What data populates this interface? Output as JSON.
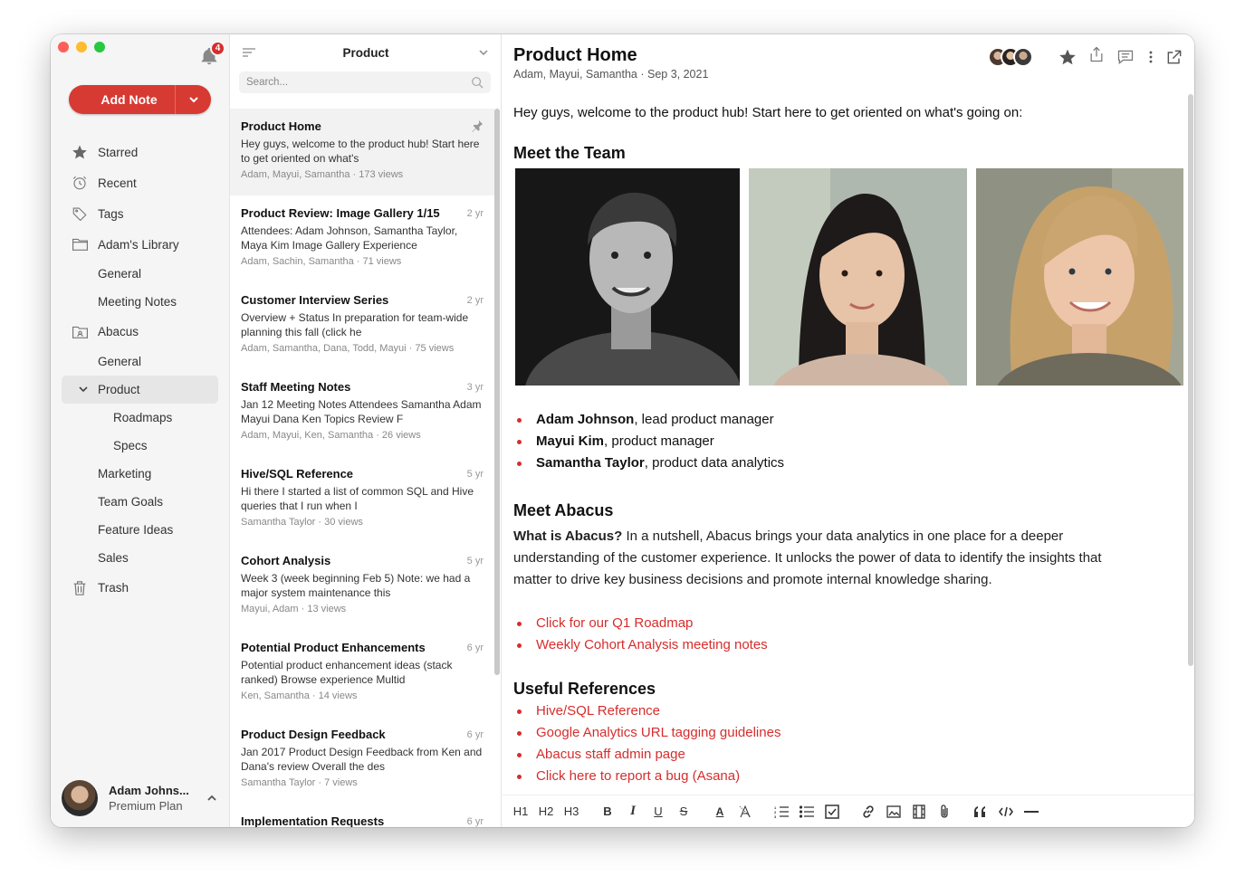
{
  "notifications": {
    "count": "4"
  },
  "sidebar": {
    "add_note_label": "Add Note",
    "items": [
      {
        "label": "Starred"
      },
      {
        "label": "Recent"
      },
      {
        "label": "Tags"
      },
      {
        "label": "Adam's Library"
      },
      {
        "label": "General"
      },
      {
        "label": "Meeting Notes"
      },
      {
        "label": "Abacus"
      },
      {
        "label": "General"
      },
      {
        "label": "Product"
      },
      {
        "label": "Roadmaps"
      },
      {
        "label": "Specs"
      },
      {
        "label": "Marketing"
      },
      {
        "label": "Team Goals"
      },
      {
        "label": "Feature Ideas"
      },
      {
        "label": "Sales"
      },
      {
        "label": "Trash"
      }
    ],
    "user": {
      "name": "Adam Johns...",
      "plan": "Premium Plan"
    }
  },
  "list": {
    "title": "Product",
    "search_placeholder": "Search...",
    "notes": [
      {
        "title": "Product Home",
        "age": "",
        "excerpt": "Hey guys, welcome to the product hub! Start here to get oriented on what's",
        "meta": "Adam, Mayui, Samantha · 173 views"
      },
      {
        "title": "Product Review: Image Gallery 1/15",
        "age": "2 yr",
        "excerpt": "Attendees: Adam Johnson, Samantha Taylor, Maya Kim Image Gallery Experience",
        "meta": "Adam, Sachin, Samantha · 71 views"
      },
      {
        "title": "Customer Interview Series",
        "age": "2 yr",
        "excerpt": "Overview + Status In preparation for team-wide planning this fall (click he",
        "meta": "Adam, Samantha, Dana, Todd, Mayui · 75 views"
      },
      {
        "title": "Staff Meeting Notes",
        "age": "3 yr",
        "excerpt": "Jan 12 Meeting Notes Attendees Samantha Adam Mayui Dana Ken Topics Review F",
        "meta": "Adam, Mayui, Ken, Samantha · 26 views"
      },
      {
        "title": "Hive/SQL Reference",
        "age": "5 yr",
        "excerpt": "Hi there I started a list of common SQL and Hive queries that I run when I",
        "meta": "Samantha Taylor · 30 views"
      },
      {
        "title": "Cohort Analysis",
        "age": "5 yr",
        "excerpt": "Week 3 (week beginning Feb 5) Note: we had a major system maintenance this",
        "meta": "Mayui, Adam · 13 views"
      },
      {
        "title": "Potential Product Enhancements",
        "age": "6 yr",
        "excerpt": "Potential product enhancement ideas (stack ranked) Browse experience Multid",
        "meta": "Ken, Samantha · 14 views"
      },
      {
        "title": "Product Design Feedback",
        "age": "6 yr",
        "excerpt": "Jan 2017 Product Design Feedback from Ken and Dana's review Overall the des",
        "meta": "Samantha Taylor · 7 views"
      },
      {
        "title": "Implementation Requests",
        "age": "6 yr",
        "excerpt": "",
        "meta": ""
      }
    ]
  },
  "doc": {
    "title": "Product Home",
    "subtitle": "Adam, Mayui, Samantha · Sep 3, 2021",
    "intro": "Hey guys, welcome to the product hub! Start here to get oriented on what's going on:",
    "team_heading": "Meet the Team",
    "team": [
      {
        "name": "Adam Johnson",
        "role": ", lead product manager"
      },
      {
        "name": "Mayui Kim",
        "role": ", product manager"
      },
      {
        "name": "Samantha Taylor",
        "role": ", product data analytics"
      }
    ],
    "abacus_heading": "Meet Abacus",
    "abacus_lead": "What is Abacus?",
    "abacus_text": " In a nutshell, Abacus brings your data analytics in one place for a deeper understanding of the customer experience. It unlocks the power of data to identify the insights that matter to drive key business decisions and promote internal knowledge sharing.",
    "abacus_links": [
      "Click for our Q1 Roadmap",
      "Weekly Cohort Analysis meeting notes"
    ],
    "refs_heading": "Useful References",
    "refs": [
      "Hive/SQL Reference",
      "Google Analytics URL tagging guidelines",
      "Abacus staff admin page",
      "Click here to report a bug (Asana)"
    ]
  },
  "format_bar": {
    "h1": "H1",
    "h2": "H2",
    "h3": "H3",
    "bold": "B",
    "italic": "I",
    "underline": "U",
    "strike": "S",
    "color": "A"
  },
  "colors": {
    "accent": "#d73a32",
    "link": "#d62d2d"
  }
}
